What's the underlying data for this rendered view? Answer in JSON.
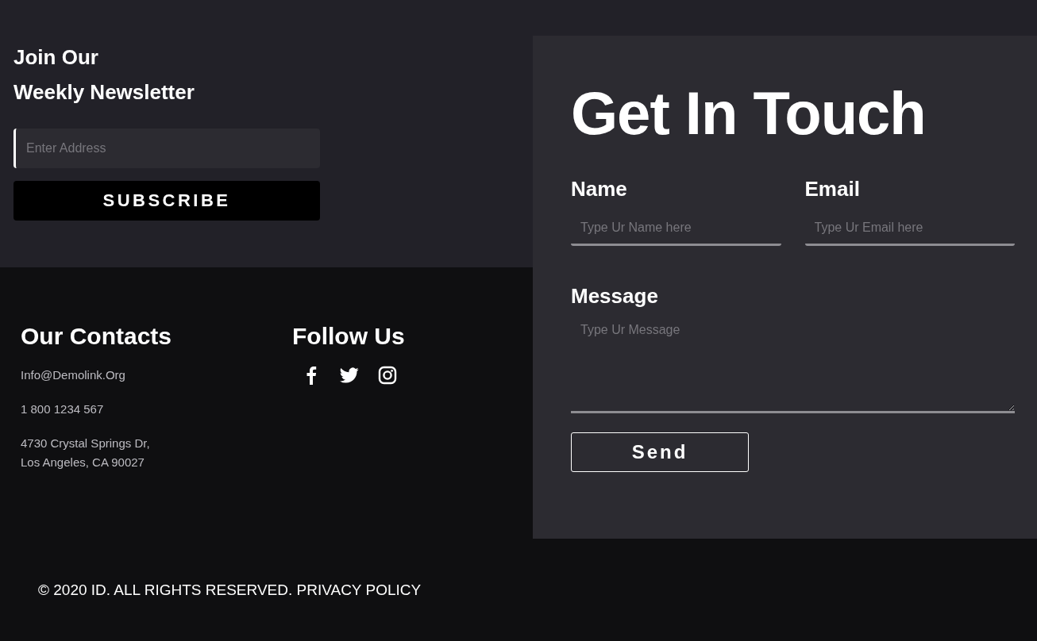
{
  "newsletter": {
    "title_lines": [
      "Join Our",
      "Weekly Newsletter"
    ],
    "email_field": {
      "placeholder": "Enter Address"
    },
    "button": "SUBSCRIBE"
  },
  "contacts": {
    "title": "Our Contacts",
    "email": "Info@Demolink.Org",
    "phone": "1 800 1234 567",
    "address_lines": [
      "4730 Crystal Springs Dr,",
      "Los Angeles, CA 90027"
    ]
  },
  "follow": {
    "title": "Follow Us",
    "icons": [
      {
        "kind": "facebook"
      },
      {
        "kind": "twitter"
      },
      {
        "kind": "instagram"
      }
    ]
  },
  "contact_form": {
    "title": "Get In Touch",
    "fields": [
      {
        "label": "Name",
        "placeholder": "Type Ur Name here"
      },
      {
        "label": "Email",
        "placeholder": "Type Ur Email here"
      }
    ],
    "message": {
      "label": "Message",
      "placeholder": "Type Ur Message"
    },
    "button": "Send"
  },
  "footer": {
    "copyright": "© 2020 ID. ALL RIGHTS RESERVED.",
    "link": "PRIVACY POLICY"
  }
}
